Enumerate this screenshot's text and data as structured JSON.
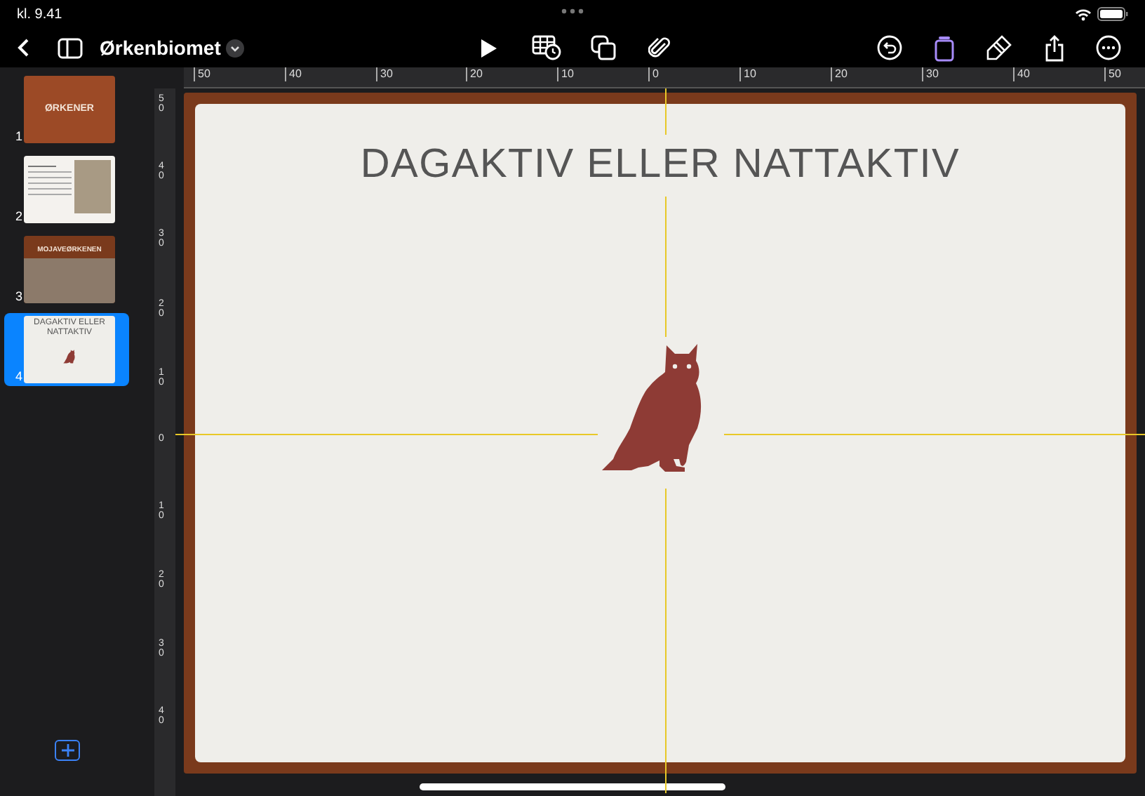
{
  "status_bar": {
    "time": "kl. 9.41"
  },
  "toolbar": {
    "title": "Ørkenbiomet"
  },
  "ruler": {
    "horizontal_labels": [
      "50",
      "40",
      "30",
      "20",
      "10",
      "0",
      "10",
      "20",
      "30",
      "40",
      "50"
    ],
    "vertical_labels": [
      "50",
      "40",
      "30",
      "20",
      "10",
      "0",
      "10",
      "20",
      "30",
      "40"
    ]
  },
  "slides": [
    {
      "number": "1",
      "kind": "title",
      "title": "ØRKENER",
      "selected": false
    },
    {
      "number": "2",
      "kind": "text-photo",
      "selected": false
    },
    {
      "number": "3",
      "kind": "photo-title",
      "title": "MOJAVEØRKENEN",
      "selected": false
    },
    {
      "number": "4",
      "kind": "owl",
      "title": "DAGAKTIV ELLER NATTAKTIV",
      "selected": true
    }
  ],
  "slide": {
    "title": "DAGAKTIV ELLER NATTAKTIV"
  }
}
